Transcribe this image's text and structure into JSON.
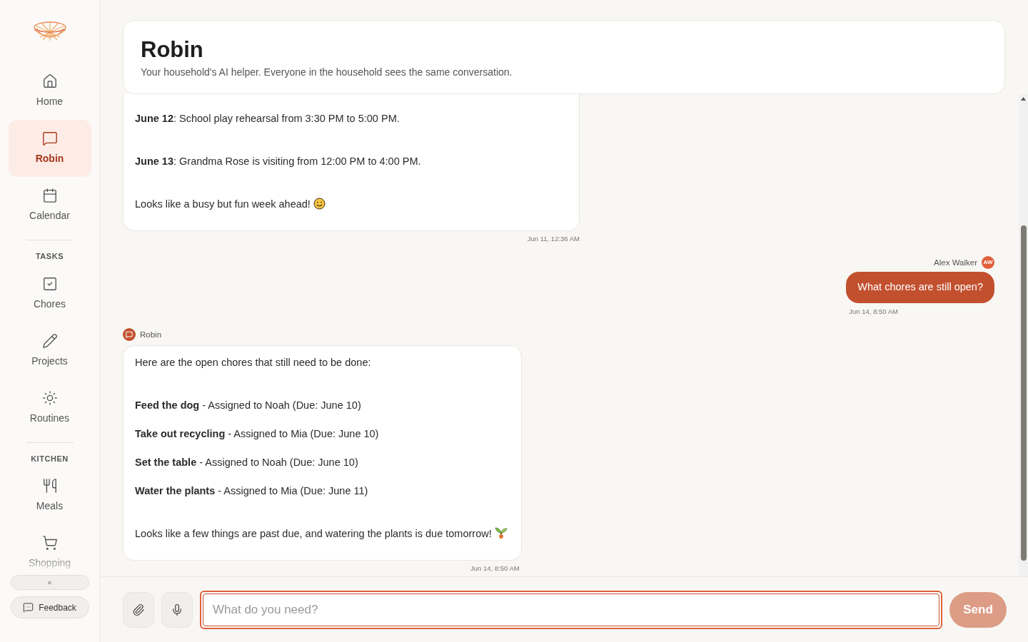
{
  "sidebar": {
    "items": [
      {
        "kind": "nav",
        "label": "Home",
        "selected": false
      },
      {
        "kind": "nav",
        "label": "Robin",
        "selected": true
      },
      {
        "kind": "nav",
        "label": "Calendar",
        "selected": false
      },
      {
        "kind": "section",
        "label": "TASKS"
      },
      {
        "kind": "nav",
        "label": "Chores",
        "selected": false
      },
      {
        "kind": "nav",
        "label": "Projects",
        "selected": false
      },
      {
        "kind": "nav",
        "label": "Routines",
        "selected": false
      },
      {
        "kind": "section",
        "label": "KITCHEN"
      },
      {
        "kind": "nav",
        "label": "Meals",
        "selected": false
      },
      {
        "kind": "nav",
        "label": "Shopping",
        "selected": false
      }
    ],
    "collapse": "«",
    "feedback": "Feedback"
  },
  "header": {
    "title": "Robin",
    "subtitle": "Your household's AI helper. Everyone in the household sees the same conversation."
  },
  "messages": [
    {
      "kind": "assistant",
      "blocks": [
        {
          "kind": "line",
          "text": "**June 12**: School play rehearsal from 3:30 PM to 5:00 PM."
        },
        {
          "kind": "line",
          "text": "**June 13**: Grandma Rose is visiting from 12:00 PM to 4:00 PM."
        },
        {
          "kind": "smile",
          "text": "Looks like a busy but fun week ahead!"
        }
      ],
      "time": "Jun 11, 12:36 AM"
    },
    {
      "kind": "user",
      "author": "Alex Walker",
      "initials": "AW",
      "text": "What chores are still open?",
      "time": "Jun 14, 8:50 AM"
    },
    {
      "kind": "assistant",
      "author": "Robin",
      "blocks": [
        {
          "kind": "intro",
          "text": "Here are the open chores that still need to be done:"
        },
        {
          "kind": "line",
          "text": "**Feed the dog** - Assigned to Noah (Due: June 10)"
        },
        {
          "kind": "line",
          "text": "**Take out recycling** - Assigned to Mia (Due: June 10)"
        },
        {
          "kind": "line",
          "text": "**Set the table** - Assigned to Noah (Due: June 10)"
        },
        {
          "kind": "line",
          "text": "**Water the plants** - Assigned to Mia (Due: June 11)"
        },
        {
          "kind": "sprout",
          "text": "Looks like a few things are past due, and watering the plants is due tomorrow!"
        }
      ],
      "time": "Jun 14, 8:50 AM"
    }
  ],
  "composer": {
    "placeholder": "What do you need?",
    "send": "Send",
    "send_disabled": true
  }
}
